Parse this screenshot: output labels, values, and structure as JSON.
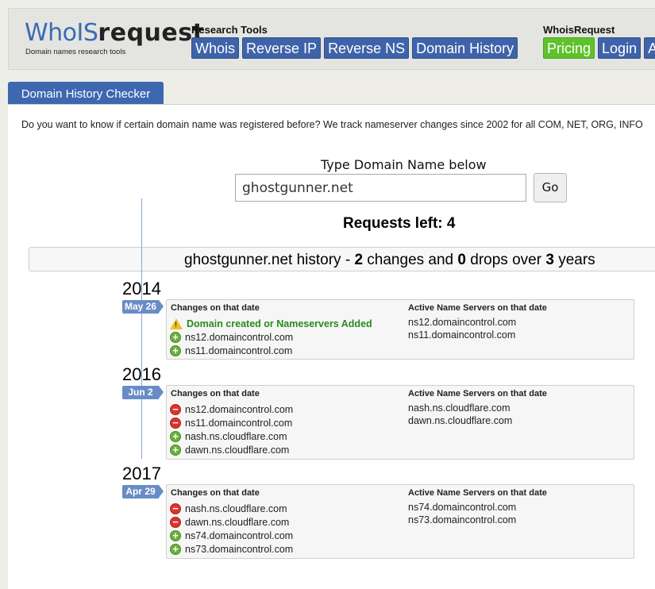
{
  "logo": {
    "part1": "WhoIS",
    "part2": "request",
    "tagline": "Domain names research tools"
  },
  "research_tools": {
    "title": "Research Tools",
    "buttons": [
      "Whois",
      "Reverse IP",
      "Reverse NS",
      "Domain History"
    ]
  },
  "whoisrequest": {
    "title": "WhoisRequest",
    "buttons": [
      "Pricing",
      "Login",
      "A"
    ]
  },
  "tab": "Domain History Checker",
  "intro": "Do you want to know if certain domain name was registered before? We track nameserver changes since 2002 for all COM, NET, ORG, INFO",
  "search": {
    "label": "Type Domain Name below",
    "value": "ghostgunner.net",
    "go_label": "Go"
  },
  "requests_left": {
    "label": "Requests left:",
    "value": "4"
  },
  "summary": {
    "domain": "ghostgunner.net",
    "history_word": "history -",
    "changes": "2",
    "changes_text": "changes and",
    "drops": "0",
    "drops_text": "drops over",
    "years": "3",
    "years_text": "years"
  },
  "column_headers": {
    "changes": "Changes on that date",
    "active": "Active Name Servers on that date"
  },
  "history": [
    {
      "year": "2014",
      "date": "May 26",
      "changes": [
        {
          "type": "created",
          "text": "Domain created or Nameservers Added"
        },
        {
          "type": "added",
          "text": "ns12.domaincontrol.com"
        },
        {
          "type": "added",
          "text": "ns11.domaincontrol.com"
        }
      ],
      "active": [
        "ns12.domaincontrol.com",
        "ns11.domaincontrol.com"
      ]
    },
    {
      "year": "2016",
      "date": "Jun 2",
      "changes": [
        {
          "type": "removed",
          "text": "ns12.domaincontrol.com"
        },
        {
          "type": "removed",
          "text": "ns11.domaincontrol.com"
        },
        {
          "type": "added",
          "text": "nash.ns.cloudflare.com"
        },
        {
          "type": "added",
          "text": "dawn.ns.cloudflare.com"
        }
      ],
      "active": [
        "nash.ns.cloudflare.com",
        "dawn.ns.cloudflare.com"
      ]
    },
    {
      "year": "2017",
      "date": "Apr 29",
      "changes": [
        {
          "type": "removed",
          "text": "nash.ns.cloudflare.com"
        },
        {
          "type": "removed",
          "text": "dawn.ns.cloudflare.com"
        },
        {
          "type": "added",
          "text": "ns74.domaincontrol.com"
        },
        {
          "type": "added",
          "text": "ns73.domaincontrol.com"
        }
      ],
      "active": [
        "ns74.domaincontrol.com",
        "ns73.domaincontrol.com"
      ]
    }
  ]
}
